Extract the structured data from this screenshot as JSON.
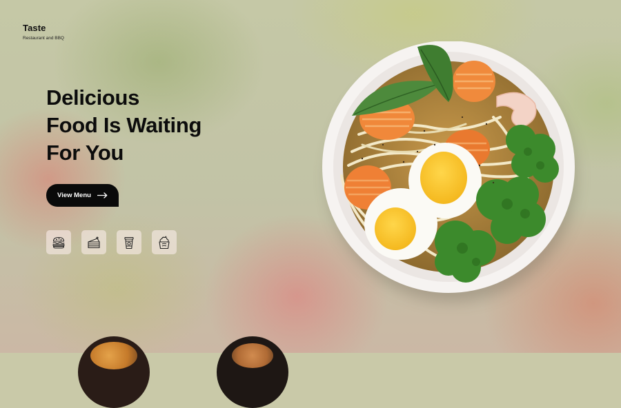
{
  "brand": {
    "title": "Taste",
    "subtitle": "Restaurant and BBQ"
  },
  "hero": {
    "line1": "Delicious",
    "line2": "Food Is Waiting",
    "line3": "For You"
  },
  "cta": {
    "label": "View Menu",
    "icon": "arrow-right-icon"
  },
  "categories": [
    {
      "icon": "burger-icon"
    },
    {
      "icon": "cake-slice-icon"
    },
    {
      "icon": "drink-cup-icon"
    },
    {
      "icon": "ice-cream-icon"
    }
  ],
  "colors": {
    "text": "#0c0c0c",
    "button_bg": "#0a0a0a",
    "button_text": "#ffffff"
  }
}
